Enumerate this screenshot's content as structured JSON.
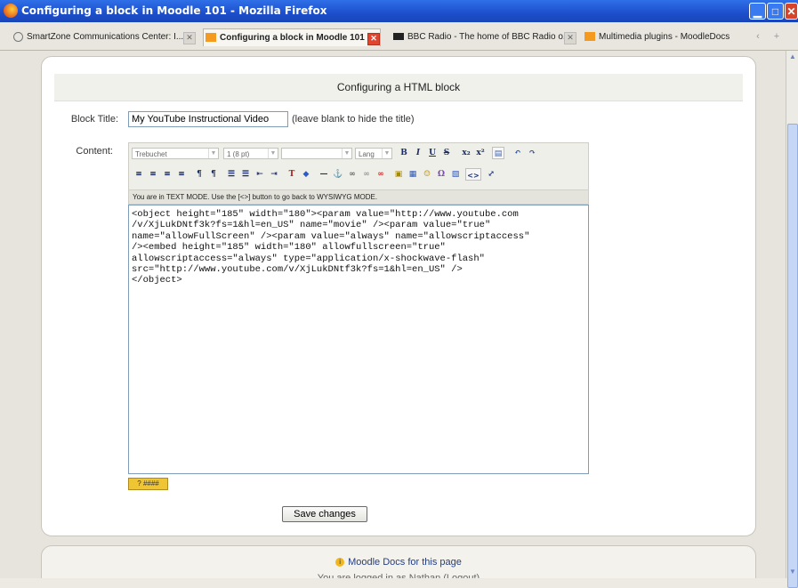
{
  "window": {
    "title": "Configuring a block in Moodle 101 - Mozilla Firefox",
    "min": "▁",
    "max": "□",
    "close": "✕"
  },
  "tabs": [
    {
      "label": "SmartZone Communications Center: I...",
      "icon": "smartzone-icon"
    },
    {
      "label": "Configuring a block in Moodle 101",
      "icon": "moodle-icon",
      "active": true
    },
    {
      "label": "BBC Radio - The home of BBC Radio o...",
      "icon": "bbc-icon"
    },
    {
      "label": "Multimedia plugins - MoodleDocs",
      "icon": "moodle-icon"
    }
  ],
  "tab_controls": {
    "scroll": "‹",
    "new_tab": "+"
  },
  "page": {
    "heading": "Configuring a HTML block",
    "block_title_label": "Block Title:",
    "block_title_value": "My YouTube Instructional Video",
    "block_title_hint": "(leave blank to hide the title)",
    "content_label": "Content:",
    "editor": {
      "font": "Trebuchet",
      "size": "1 (8 pt)",
      "style": "",
      "lang": "Lang",
      "buttons_row1": [
        "B",
        "I",
        "U",
        "S",
        "x₂",
        "x²",
        "▤",
        "↶",
        "↷"
      ],
      "buttons_row2": [
        "≡",
        "≡",
        "≡",
        "≡",
        "¶",
        "¶",
        "☰",
        "☰",
        "⇤",
        "⇥",
        "T",
        "◆",
        "—",
        "⚓",
        "∞",
        "∞",
        "∞",
        "▣",
        "▦",
        "☺",
        "Ω",
        "▧",
        "<>",
        "⤢"
      ],
      "mode_message": "You are in TEXT MODE. Use the [<>] button to go back to WYSIWYG MODE.",
      "code": "<object height=\"185\" width=\"180\"><param value=\"http://www.youtube.com\n/v/XjLukDNtf3k?fs=1&hl=en_US\" name=\"movie\" /><param value=\"true\"\nname=\"allowFullScreen\" /><param value=\"always\" name=\"allowscriptaccess\"\n/><embed height=\"185\" width=\"180\" allowfullscreen=\"true\"\nallowscriptaccess=\"always\" type=\"application/x-shockwave-flash\"\nsrc=\"http://www.youtube.com/v/XjLukDNtf3k?fs=1&hl=en_US\" />\n</object>"
    },
    "help_label": "? ####",
    "save_label": "Save changes",
    "footer_link": "Moodle Docs for this page",
    "footer_cut": "You are logged in as Nathan (Logout)"
  }
}
